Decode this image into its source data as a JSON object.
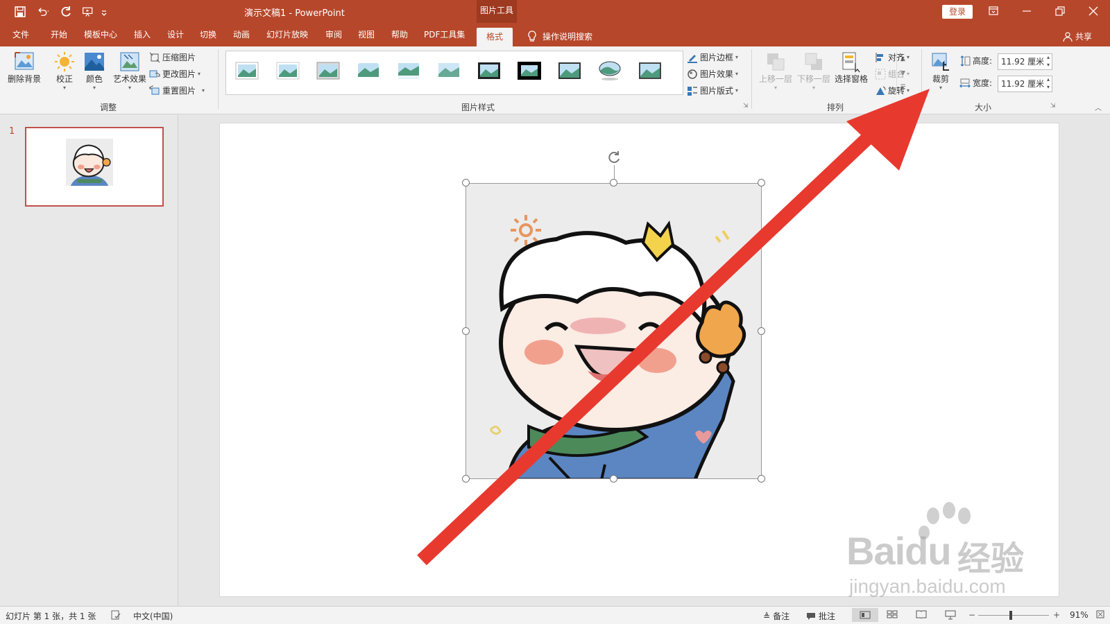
{
  "titlebar": {
    "doc_title": "演示文稿1 - PowerPoint",
    "context_tab": "图片工具",
    "login": "登录"
  },
  "tabs": {
    "items": [
      "文件",
      "开始",
      "模板中心",
      "插入",
      "设计",
      "切换",
      "动画",
      "幻灯片放映",
      "审阅",
      "视图",
      "帮助",
      "PDF工具集",
      "格式"
    ],
    "active": "格式",
    "search": "操作说明搜索",
    "share": "共享"
  },
  "ribbon": {
    "adjust": {
      "remove_bg": "删除背景",
      "correct": "校正",
      "color": "颜色",
      "art_effect": "艺术效果",
      "compress": "压缩图片",
      "change": "更改图片",
      "reset": "重置图片",
      "group": "调整"
    },
    "styles": {
      "border": "图片边框",
      "effect": "图片效果",
      "layout": "图片版式",
      "group": "图片样式"
    },
    "arrange": {
      "bring_forward": "上移一层",
      "send_backward": "下移一层",
      "selection_pane": "选择窗格",
      "align": "对齐",
      "group_btn": "组合",
      "rotate": "旋转",
      "group": "排列"
    },
    "size": {
      "crop": "裁剪",
      "height_label": "高度:",
      "height_value": "11.92 厘米",
      "width_label": "宽度:",
      "width_value": "11.92 厘米",
      "group": "大小"
    }
  },
  "slides_panel": {
    "slide_number": "1"
  },
  "statusbar": {
    "slide_info": "幻灯片 第 1 张，共 1 张",
    "language": "中文(中国)",
    "notes": "备注",
    "comments": "批注",
    "zoom": "91%"
  },
  "watermark": {
    "brand": "Baidu",
    "brand_cn": "经验",
    "url": "jingyan.baidu.com"
  },
  "colors": {
    "accent": "#b7472a",
    "arrow": "#e8392f"
  }
}
